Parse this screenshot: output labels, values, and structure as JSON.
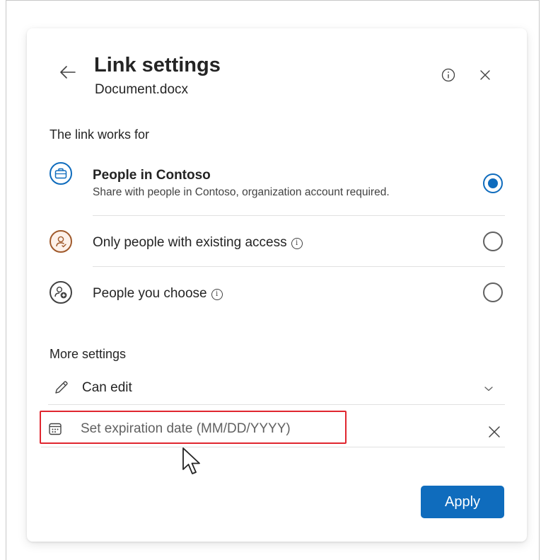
{
  "dialog": {
    "title": "Link settings",
    "subtitle": "Document.docx",
    "back_icon": "arrow-left-icon",
    "info_icon": "info-icon",
    "close_icon": "close-icon"
  },
  "link_works_for": {
    "heading": "The link works for",
    "selected": "people-in-contoso",
    "options": [
      {
        "id": "people-in-contoso",
        "icon": "briefcase-icon",
        "title": "People in Contoso",
        "description": "Share with people in Contoso, organization account required.",
        "checked": true
      },
      {
        "id": "existing-access",
        "icon": "person-check-icon",
        "title": "Only people with existing access",
        "info": "ⓘ",
        "checked": false
      },
      {
        "id": "people-you-choose",
        "icon": "person-add-icon",
        "title": "People you choose",
        "info": "ⓘ",
        "checked": false
      }
    ]
  },
  "more_settings": {
    "heading": "More settings",
    "permission": {
      "icon": "pencil-icon",
      "label": "Can edit",
      "chevron": "chevron-down-icon"
    },
    "expiration": {
      "icon": "calendar-icon",
      "placeholder": "Set expiration date (MM/DD/YYYY)",
      "clear_icon": "close-icon"
    }
  },
  "footer": {
    "apply_label": "Apply"
  },
  "colors": {
    "accent": "#0f6cbd",
    "highlight": "#e0262f",
    "person_icon": "#a05a2c"
  }
}
